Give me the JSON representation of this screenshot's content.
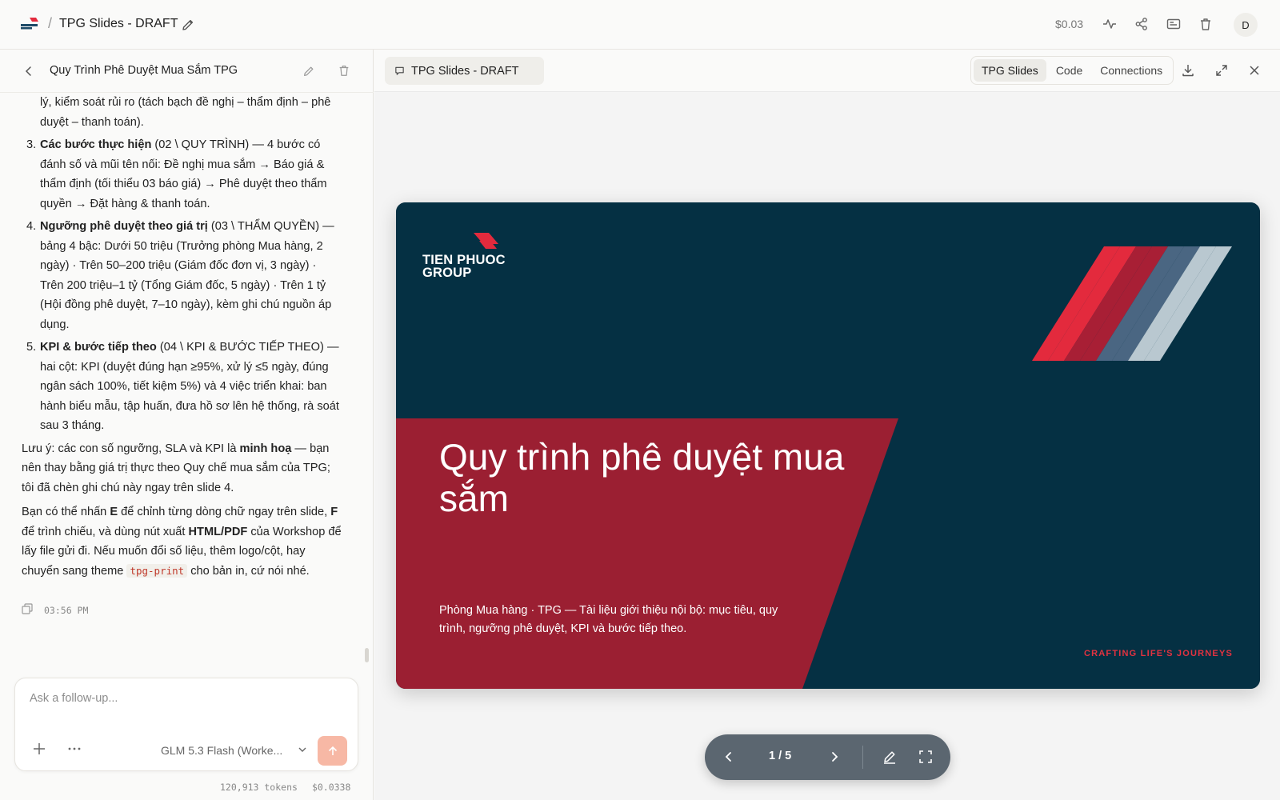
{
  "topbar": {
    "title": "TPG Slides - DRAFT",
    "separator": "/",
    "cost": "$0.03",
    "avatar_letter": "D",
    "icons": [
      "activity-icon",
      "share-icon",
      "slides-icon",
      "trash-icon"
    ]
  },
  "chat": {
    "title": "Quy Trình Phê Duyệt Mua Sắm TPG",
    "intro_fragment": "lý, kiểm soát rủi ro (tách bạch đề nghị – thẩm định – phê duyệt – thanh toán).",
    "items": [
      {
        "num": "3.",
        "bold": "Các bước thực hiện",
        "text": " (02 \\ QUY TRÌNH) — 4 bước có đánh số và mũi tên nối: Đề nghị mua sắm → Báo giá & thẩm định (tối thiểu 03 báo giá) → Phê duyệt theo thẩm quyền → Đặt hàng & thanh toán."
      },
      {
        "num": "4.",
        "bold": "Ngưỡng phê duyệt theo giá trị",
        "text": " (03 \\ THẨM QUYỀN) — bảng 4 bậc: Dưới 50 triệu (Trưởng phòng Mua hàng, 2 ngày) · Trên 50–200 triệu (Giám đốc đơn vị, 3 ngày) · Trên 200 triệu–1 tỷ (Tổng Giám đốc, 5 ngày) · Trên 1 tỷ (Hội đồng phê duyệt, 7–10 ngày), kèm ghi chú nguồn áp dụng."
      },
      {
        "num": "5.",
        "bold": "KPI & bước tiếp theo",
        "text": " (04 \\ KPI & BƯỚC TIẾP THEO) — hai cột: KPI (duyệt đúng hạn ≥95%, xử lý ≤5 ngày, đúng ngân sách 100%, tiết kiệm 5%) và 4 việc triển khai: ban hành biểu mẫu, tập huấn, đưa hồ sơ lên hệ thống, rà soát sau 3 tháng."
      }
    ],
    "note_prefix": "Lưu ý: các con số ngưỡng, SLA và KPI là ",
    "note_bold": "minh hoạ",
    "note_suffix": " — bạn nên thay bằng giá trị thực theo Quy chế mua sắm của TPG; tôi đã chèn ghi chú này ngay trên slide 4.",
    "tip_1": "Bạn có thể nhấn ",
    "tip_key_e": "E",
    "tip_2": " để chỉnh từng dòng chữ ngay trên slide, ",
    "tip_key_f": "F",
    "tip_3": " để trình chiếu, và dùng nút xuất ",
    "tip_export": "HTML/PDF",
    "tip_4": " của Workshop để lấy file gửi đi. Nếu muốn đổi số liệu, thêm logo/cột, hay chuyển sang theme ",
    "tip_code": "tpg-print",
    "tip_5": " cho bản in, cứ nói nhé.",
    "timestamp": "03:56 PM"
  },
  "composer": {
    "placeholder": "Ask a follow-up...",
    "model": "GLM 5.3 Flash (Worke...",
    "tokens": "120,913 tokens",
    "cost": "$0.0338"
  },
  "preview": {
    "doc_chip": "TPG Slides - DRAFT",
    "tabs": [
      "TPG Slides",
      "Code",
      "Connections"
    ],
    "active_tab": "TPG Slides"
  },
  "slide": {
    "brand_line1": "TIEN PHUOC",
    "brand_line2": "GROUP",
    "title": "Quy trình phê duyệt mua sắm",
    "subtitle": "Phòng Mua hàng · TPG — Tài liệu giới thiệu nội bộ: mục tiêu, quy trình, ngưỡng phê duyệt, KPI và bước tiếp theo.",
    "tagline": "CRAFTING LIFE'S JOURNEYS",
    "colors": {
      "navy": "#053043",
      "red": "#9b1f32",
      "accent_red": "#e32a3d",
      "dark_red": "#a81f35",
      "steel": "#4a6682",
      "light": "#b9c8d0"
    }
  },
  "pager": {
    "label": "1 / 5",
    "current": 1,
    "total": 5
  }
}
